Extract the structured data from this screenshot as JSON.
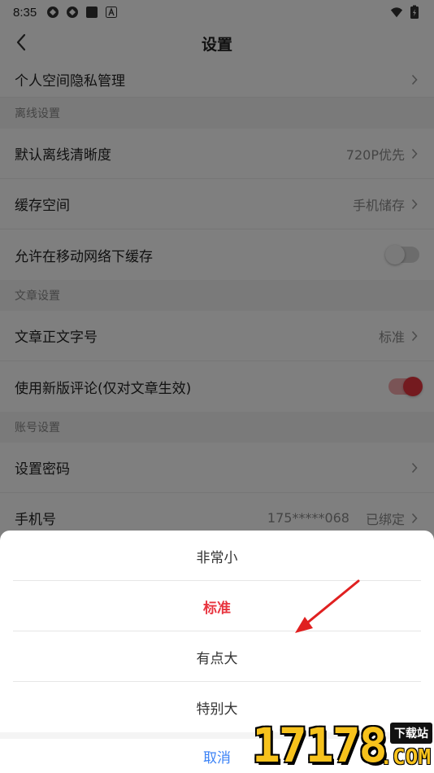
{
  "status_bar": {
    "time": "8:35",
    "icons_left": [
      "app-notification-icon",
      "app-notification-icon",
      "square-icon",
      "a-badge-icon"
    ],
    "icons_right": [
      "wifi-icon",
      "battery-charging-icon"
    ]
  },
  "header": {
    "title": "设置"
  },
  "settings": {
    "privacy": {
      "label": "个人空间隐私管理"
    },
    "offline_section": "离线设置",
    "offline_quality": {
      "label": "默认离线清晰度",
      "value": "720P优先"
    },
    "cache_space": {
      "label": "缓存空间",
      "value": "手机储存"
    },
    "mobile_cache": {
      "label": "允许在移动网络下缓存",
      "enabled": false
    },
    "article_section": "文章设置",
    "font_size": {
      "label": "文章正文字号",
      "value": "标准"
    },
    "new_comments": {
      "label": "使用新版评论(仅对文章生效)",
      "enabled": true
    },
    "account_section": "账号设置",
    "password": {
      "label": "设置密码"
    },
    "phone": {
      "label": "手机号",
      "number": "175*****068",
      "status": "已绑定"
    }
  },
  "sheet": {
    "options": [
      {
        "label": "非常小",
        "selected": false
      },
      {
        "label": "标准",
        "selected": true
      },
      {
        "label": "有点大",
        "selected": false
      },
      {
        "label": "特别大",
        "selected": false
      }
    ],
    "cancel": "取消"
  },
  "colors": {
    "accent_red": "#e8343f",
    "link_blue": "#3b82f6",
    "watermark_yellow": "#f7c21c"
  },
  "watermark": {
    "digits": "17178",
    "tag": "下载站",
    "suffix": ".COM"
  }
}
